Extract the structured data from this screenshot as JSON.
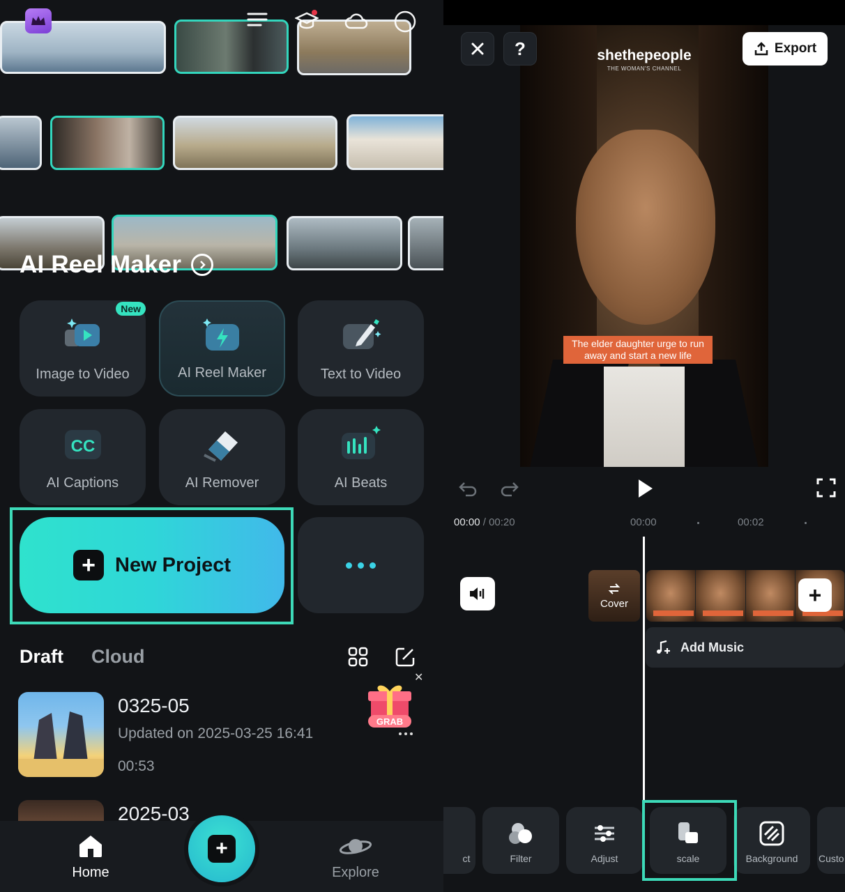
{
  "left_panel": {
    "reel_title": "AI Reel Maker",
    "tools": [
      {
        "label": "Image to Video",
        "icon": "image-to-video-icon",
        "badge": "New"
      },
      {
        "label": "AI Reel Maker",
        "icon": "reel-maker-icon"
      },
      {
        "label": "Text to Video",
        "icon": "text-to-video-icon"
      },
      {
        "label": "AI Captions",
        "icon": "cc-icon"
      },
      {
        "label": "AI Remover",
        "icon": "eraser-icon"
      },
      {
        "label": "AI Beats",
        "icon": "beats-icon"
      }
    ],
    "new_project_label": "New Project",
    "tabs": {
      "draft": "Draft",
      "cloud": "Cloud"
    },
    "projects": [
      {
        "name": "0325-05",
        "updated": "Updated on 2025-03-25 16:41",
        "duration": "00:53"
      },
      {
        "name": "2025-03"
      }
    ],
    "gift_label": "GRAB",
    "nav": {
      "home": "Home",
      "explore": "Explore"
    }
  },
  "right_panel": {
    "export_label": "Export",
    "video": {
      "brand": "shethepeople",
      "brand_sub": "THE WOMAN'S CHANNEL",
      "caption": "The elder daughter urge to run away and start a new life"
    },
    "time": {
      "current": "00:00",
      "separator": " / ",
      "total": "00:20",
      "mark1": "00:00",
      "mark2": "00:02"
    },
    "cover_label": "Cover",
    "add_music_label": "Add Music",
    "tools": [
      {
        "label": "ct"
      },
      {
        "label": "Filter",
        "icon": "filter-icon"
      },
      {
        "label": "Adjust",
        "icon": "adjust-icon"
      },
      {
        "label": "scale",
        "icon": "scale-icon"
      },
      {
        "label": "Background",
        "icon": "background-icon"
      },
      {
        "label": "Custo"
      }
    ]
  },
  "colors": {
    "accent": "#3ddab8",
    "caption_bg": "#e0653a",
    "panel": "#121417"
  }
}
